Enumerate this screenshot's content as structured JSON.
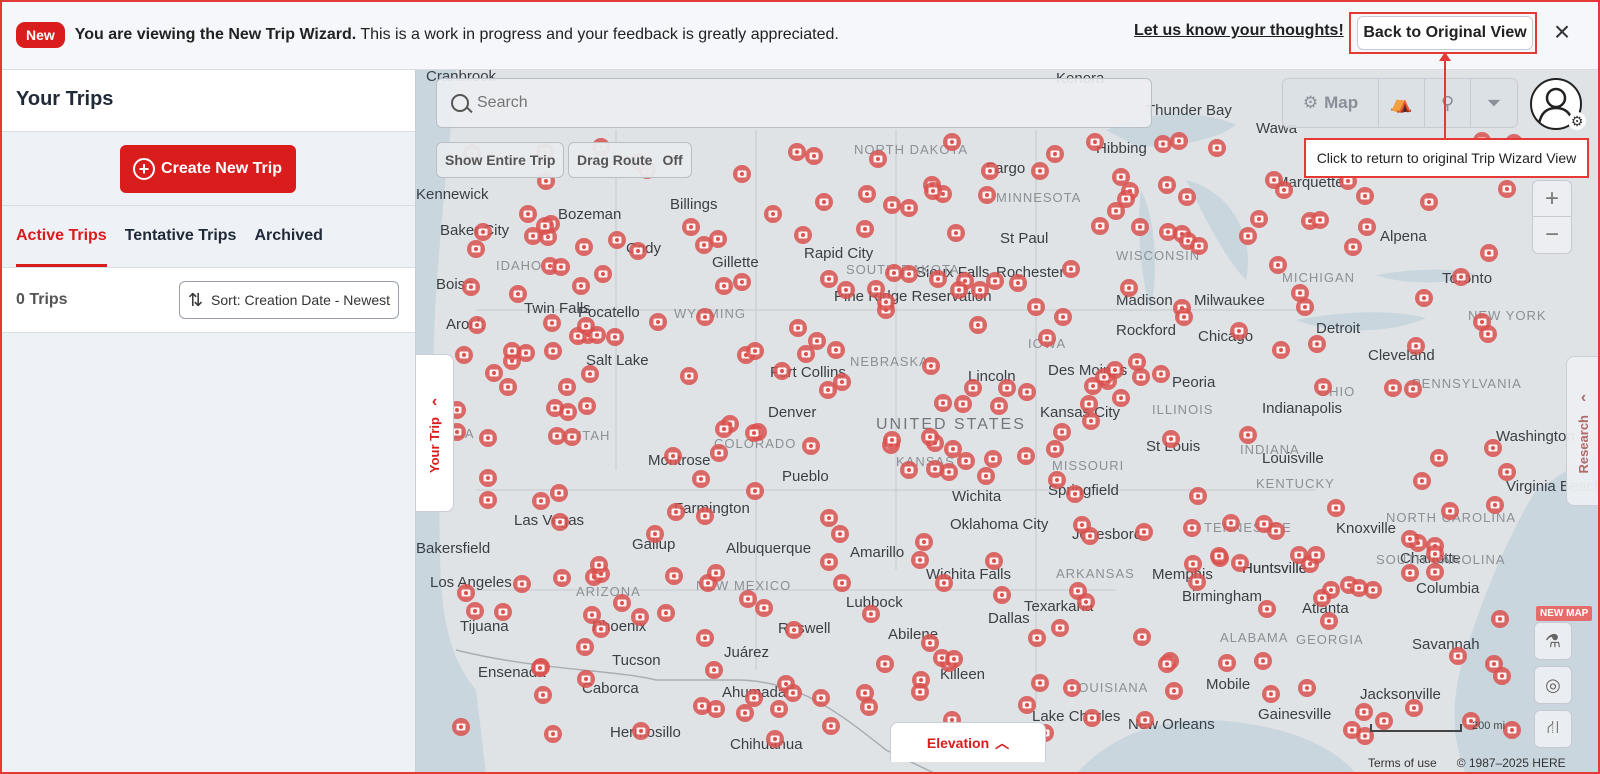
{
  "banner": {
    "badge": "New",
    "bold_text": "You are viewing the New Trip Wizard.",
    "text": " This is a work in progress and your feedback is greatly appreciated.",
    "feedback_link": "Let us know your thoughts!",
    "back_button": "Back to Original View",
    "close_icon": "×"
  },
  "sidebar": {
    "title": "Your Trips",
    "create_button": "Create New Trip",
    "tabs": [
      {
        "label": "Active Trips",
        "active": true
      },
      {
        "label": "Tentative Trips",
        "active": false
      },
      {
        "label": "Archived",
        "active": false
      }
    ],
    "trip_count": "0 Trips",
    "sort_label": "Sort: Creation Date - Newest"
  },
  "map": {
    "search_placeholder": "Search",
    "show_entire_trip": "Show Entire Trip",
    "drag_route_label": "Drag Route",
    "drag_route_state": "Off",
    "map_button": "Map",
    "tooltip": "Click to return to original Trip Wizard View",
    "your_trip_tab": "Your Trip",
    "research_tab": "Research",
    "new_map_badge": "NEW MAP",
    "elevation": "Elevation",
    "scale_label": "200 mi",
    "terms": "Terms of use",
    "copyright": "© 1987–2025 HERE",
    "zoom_in": "+",
    "zoom_out": "−",
    "city_labels": [
      "Thunder Bay",
      "Wawa",
      "Kenora",
      "Cranbrook",
      "Hibbing",
      "Marquette",
      "Alpena",
      "Huntsville",
      "Bozeman",
      "Billings",
      "Kennewick",
      "Baker City",
      "Cody",
      "Gillette",
      "Rapid City",
      "Pine Ridge Reservation",
      "Fargo",
      "St Paul",
      "Rochester",
      "Sioux Falls",
      "Toronto",
      "Milwaukee",
      "Madison",
      "Rockford",
      "Chicago",
      "Detroit",
      "Cleveland",
      "Boise",
      "Twin Falls",
      "Pocatello",
      "Arock",
      "Salt Lake",
      "Fort Collins",
      "Denver",
      "Pueblo",
      "Lincoln",
      "Des Moines",
      "Peoria",
      "Kansas City",
      "Indianapolis",
      "Washington",
      "St Louis",
      "Louisville",
      "Springfield",
      "Wichita",
      "Oklahoma City",
      "Jonesboro",
      "Memphis",
      "Huntsville",
      "Atlanta",
      "Columbia",
      "Virginia Beach",
      "Charlotte",
      "Knoxville",
      "Las Vegas",
      "Bakersfield",
      "Los Angeles",
      "Tijuana",
      "Ensenada",
      "Phoenix",
      "Tucson",
      "Albuquerque",
      "Amarillo",
      "Lubbock",
      "Wichita Falls",
      "Abilene",
      "Dallas",
      "Killeen",
      "Juárez",
      "Ahumada",
      "Hermosillo",
      "Chihuahua",
      "Birmingham",
      "Savannah",
      "Jacksonville",
      "Gainesville",
      "New Orleans",
      "Lake Charles",
      "Mobile",
      "Texarkana",
      "Montrose",
      "Gallup",
      "Farmington",
      "Roswell",
      "Caborca"
    ],
    "region_labels": [
      "NORTH DAKOTA",
      "SOUTH DAKOTA",
      "MINNESOTA",
      "WISCONSIN",
      "IOWA",
      "NEBRASKA",
      "KANSAS",
      "MISSOURI",
      "ILLINOIS",
      "INDIANA",
      "IDAHO",
      "UTAH",
      "NEVADA",
      "ARIZONA",
      "NEW MEXICO",
      "COLORADO",
      "WYOMING",
      "ARKANSAS",
      "ALABAMA",
      "GEORGIA",
      "LOUISIANA",
      "PENNSYLVANIA",
      "NORTH CAROLINA",
      "SOUTH CAROLINA",
      "NEW YORK",
      "KENTUCKY",
      "TENNESSEE",
      "OHIO",
      "MICHIGAN"
    ],
    "country_label": "UNITED STATES"
  },
  "colors": {
    "accent": "#d91c1c",
    "outline_annotation": "#e53935",
    "map_water": "#c9d6de",
    "map_land": "#dfe3e6",
    "pin": "#d9524f"
  }
}
